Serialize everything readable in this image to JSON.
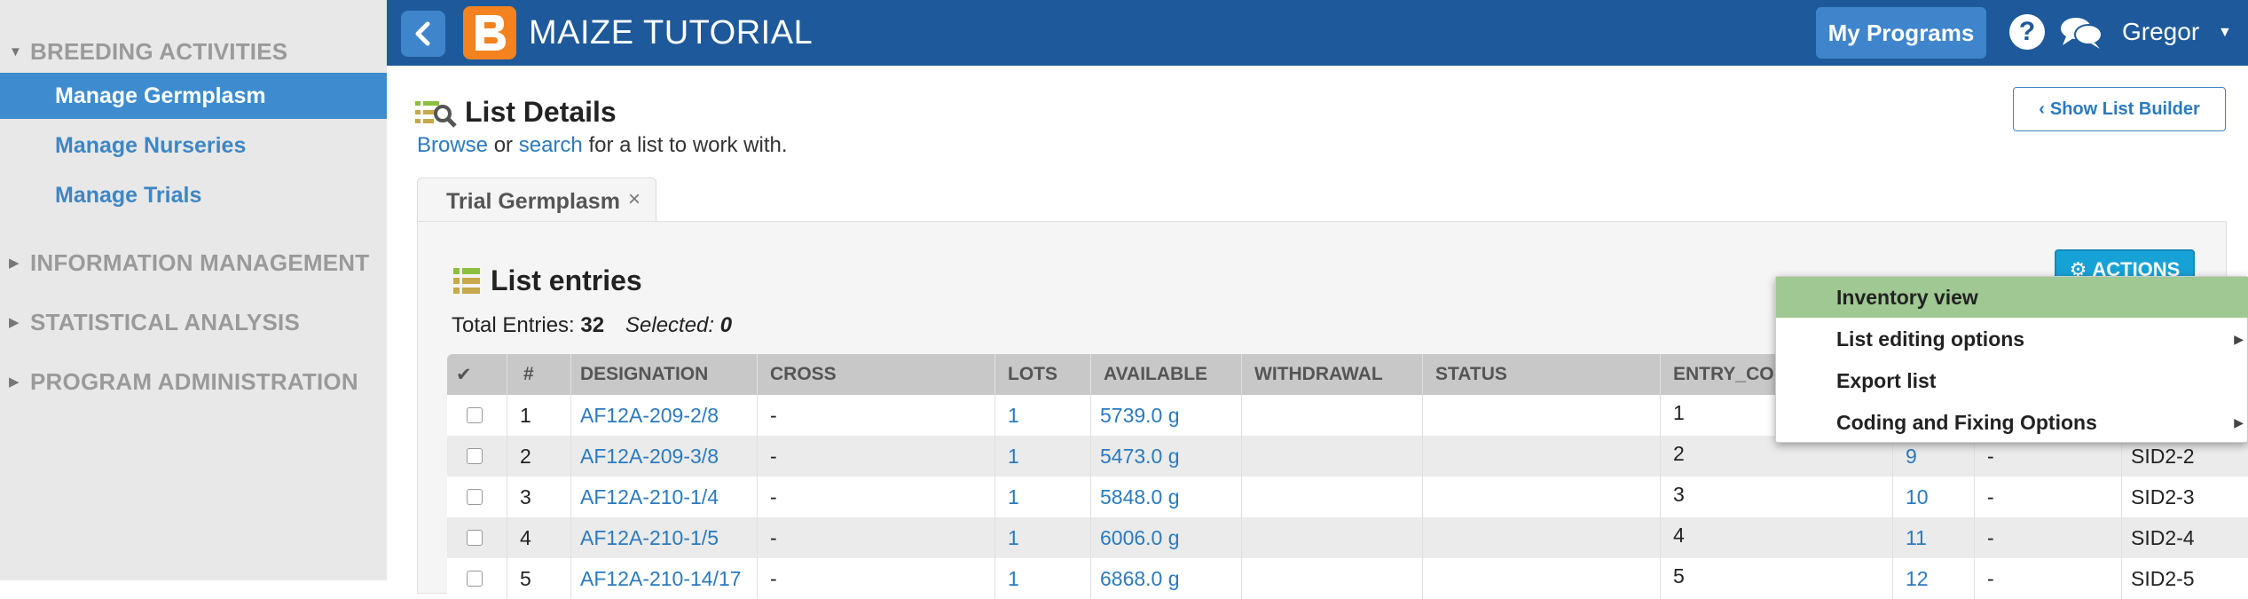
{
  "sidebar": {
    "sections": [
      {
        "label": "BREEDING ACTIVITIES",
        "expanded": true,
        "items": [
          {
            "label": "Manage Germplasm",
            "active": true
          },
          {
            "label": "Manage Nurseries",
            "active": false
          },
          {
            "label": "Manage Trials",
            "active": false
          }
        ]
      },
      {
        "label": "INFORMATION MANAGEMENT",
        "expanded": false,
        "items": []
      },
      {
        "label": "STATISTICAL ANALYSIS",
        "expanded": false,
        "items": []
      },
      {
        "label": "PROGRAM ADMINISTRATION",
        "expanded": false,
        "items": []
      }
    ]
  },
  "topbar": {
    "app_title": "MAIZE TUTORIAL",
    "my_programs": "My Programs",
    "help_glyph": "?",
    "user_name": "Gregor",
    "colors": {
      "bar": "#1e5a9b",
      "button": "#3e85cb",
      "logo": "#f4821f"
    }
  },
  "list_details": {
    "title": "List Details",
    "browse": "Browse",
    "or": "or",
    "search": "search",
    "suffix": "for a list to work with.",
    "show_builder": "Show List Builder"
  },
  "tab": {
    "label": "Trial Germplasm",
    "close": "×"
  },
  "list_entries": {
    "title": "List entries",
    "total_label": "Total Entries:",
    "total_value": "32",
    "selected_label": "Selected:",
    "selected_value": "0",
    "actions_label": "ACTIONS"
  },
  "table": {
    "headers": [
      "✔",
      "#",
      "DESIGNATION",
      "CROSS",
      "LOTS",
      "AVAILABLE",
      "WITHDRAWAL",
      "STATUS",
      "ENTRY_COD",
      "",
      "",
      ""
    ],
    "rows": [
      {
        "num": "1",
        "designation": "AF12A-209-2/8",
        "cross": "-",
        "lots": "1",
        "available": "5739.0 g",
        "withdrawal": "",
        "status": "",
        "entry_code": "1",
        "gid": "",
        "dash": "",
        "source": ""
      },
      {
        "num": "2",
        "designation": "AF12A-209-3/8",
        "cross": "-",
        "lots": "1",
        "available": "5473.0 g",
        "withdrawal": "",
        "status": "",
        "entry_code": "2",
        "gid": "9",
        "dash": "-",
        "source": "SID2-2"
      },
      {
        "num": "3",
        "designation": "AF12A-210-1/4",
        "cross": "-",
        "lots": "1",
        "available": "5848.0 g",
        "withdrawal": "",
        "status": "",
        "entry_code": "3",
        "gid": "10",
        "dash": "-",
        "source": "SID2-3"
      },
      {
        "num": "4",
        "designation": "AF12A-210-1/5",
        "cross": "-",
        "lots": "1",
        "available": "6006.0 g",
        "withdrawal": "",
        "status": "",
        "entry_code": "4",
        "gid": "11",
        "dash": "-",
        "source": "SID2-4"
      },
      {
        "num": "5",
        "designation": "AF12A-210-14/17",
        "cross": "-",
        "lots": "1",
        "available": "6868.0 g",
        "withdrawal": "",
        "status": "",
        "entry_code": "5",
        "gid": "12",
        "dash": "-",
        "source": "SID2-5"
      }
    ]
  },
  "actions_menu": {
    "items": [
      {
        "label": "Inventory view",
        "highlighted": true,
        "submenu": false
      },
      {
        "label": "List editing options",
        "highlighted": false,
        "submenu": true
      },
      {
        "label": "Export list",
        "highlighted": false,
        "submenu": false
      },
      {
        "label": "Coding and Fixing Options",
        "highlighted": false,
        "submenu": true
      }
    ]
  }
}
